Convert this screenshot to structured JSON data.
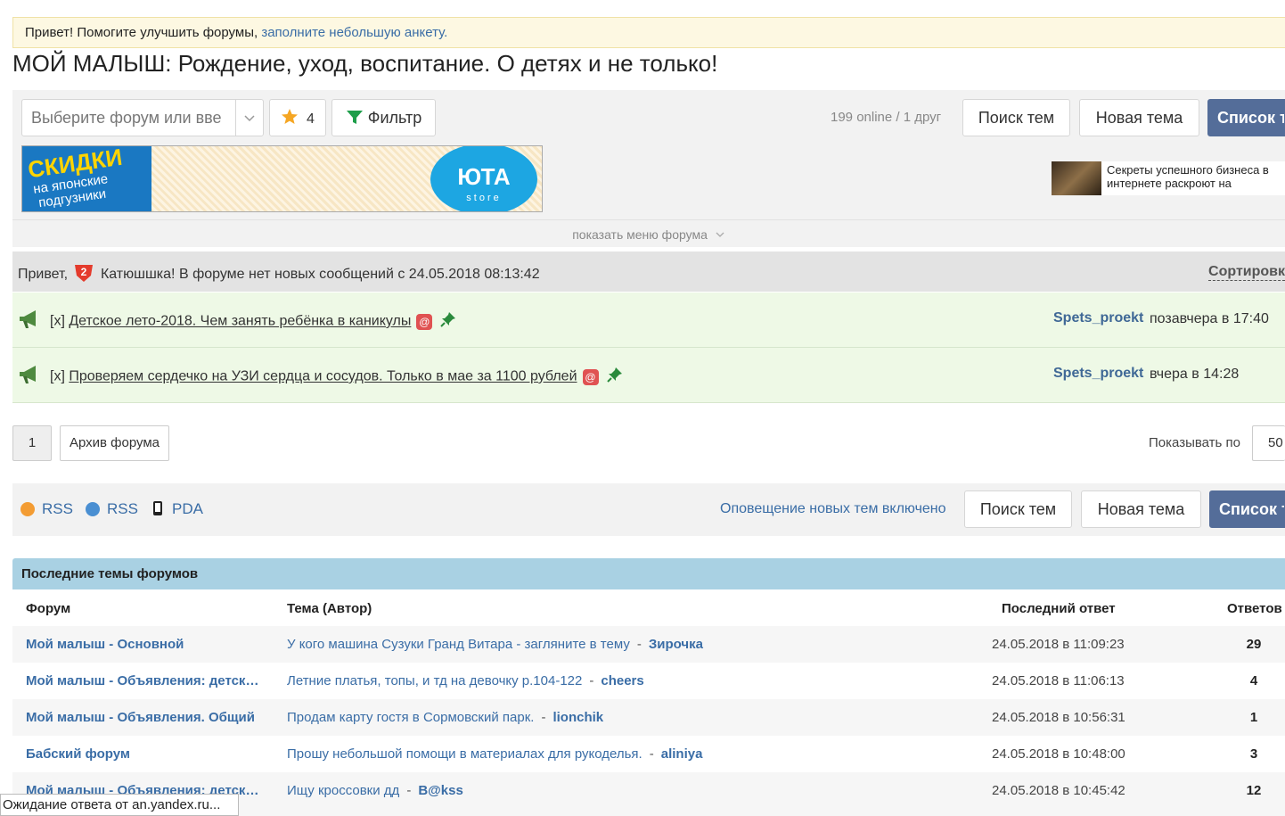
{
  "notice": {
    "text": "Привет! Помогите улучшить форумы, ",
    "link": "заполните небольшую анкету."
  },
  "page_title": "МОЙ МАЛЫШ: Рождение, уход, воспитание. О детях и не только!",
  "toolbar": {
    "forum_select_placeholder": "Выберите форум или вве",
    "favorites_count": "4",
    "filter_label": "Фильтр",
    "online_text": "199 online / 1 друг",
    "search_topics": "Поиск тем",
    "new_topic": "Новая тема",
    "topic_list": "Список т"
  },
  "banner": {
    "left_line1": "СКИДКИ",
    "left_line2": "на японские",
    "left_line3": "подгузники",
    "brand": "ЮТА",
    "brand_sub": "store"
  },
  "side_ad": {
    "text": "Секреты успешного бизнеса в интернете раскроют на"
  },
  "forum_menu": "показать меню форума",
  "greeting": {
    "prefix": "Привет,",
    "badge": "2",
    "text": "Катюшшка! В форуме нет новых сообщений с 24.05.2018 08:13:42",
    "sort": "Сортировк"
  },
  "sticky": [
    {
      "prefix": "[x]",
      "title": "Детское лето-2018. Чем занять ребёнка в каникулы",
      "author": "Spets_proekt",
      "when": "позавчера в 17:40"
    },
    {
      "prefix": "[x]",
      "title": "Проверяем сердечко на УЗИ сердца и сосудов. Только в мае за 1100 рублей",
      "author": "Spets_proekt",
      "when": "вчера в 14:28"
    }
  ],
  "pager": {
    "page": "1",
    "archive": "Архив форума",
    "show_per": "Показывать по",
    "per_value": "50"
  },
  "bottom_bar": {
    "rss1": "RSS",
    "rss2": "RSS",
    "pda": "PDA",
    "notify": "Оповещение новых тем включено",
    "search_topics": "Поиск тем",
    "new_topic": "Новая тема",
    "topic_list": "Список т"
  },
  "latest": {
    "title": "Последние темы форумов",
    "headers": {
      "forum": "Форум",
      "topic": "Тема (Автор)",
      "last": "Последний ответ",
      "replies": "Ответов"
    },
    "rows": [
      {
        "forum": "Мой малыш - Основной",
        "topic": "У кого машина Сузуки Гранд Витара - загляните в тему",
        "author": "Зирочка",
        "date": "24.05.2018 в 11:09:23",
        "replies": "29"
      },
      {
        "forum": "Мой малыш - Объявления: детская одежда",
        "topic": "Летние платья, топы, и тд на девочку р.104-122",
        "author": "cheers",
        "date": "24.05.2018 в 11:06:13",
        "replies": "4"
      },
      {
        "forum": "Мой малыш - Объявления. Общий",
        "topic": "Продам карту гостя в Сормовский парк.",
        "author": "lionchik",
        "date": "24.05.2018 в 10:56:31",
        "replies": "1"
      },
      {
        "forum": "Бабский форум",
        "topic": "Прошу небольшой помощи в материалах для рукоделья.",
        "author": "aliniya",
        "date": "24.05.2018 в 10:48:00",
        "replies": "3"
      },
      {
        "forum": "Мой малыш - Объявления: детская обувь",
        "topic": "Ищу кроссовки дд",
        "author": "B@kss",
        "date": "24.05.2018 в 10:45:42",
        "replies": "12"
      }
    ]
  },
  "status": "Ожидание ответа от an.yandex.ru..."
}
